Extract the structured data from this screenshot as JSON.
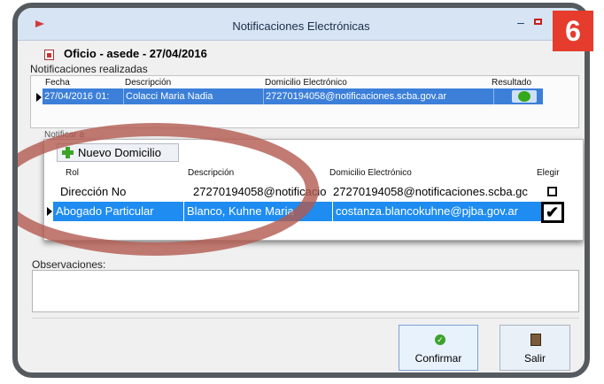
{
  "window": {
    "title": "Notificaciones Electrónicas",
    "minimize_glyph": "–"
  },
  "step_badge": "6",
  "document": {
    "title": "Oficio - asede - 27/04/2016"
  },
  "notifications": {
    "section_label": "Notificaciones realizadas",
    "columns": [
      "Fecha",
      "Descripción",
      "Domicilio Electrónico",
      "Resultado"
    ],
    "rows": [
      {
        "fecha": "27/04/2016 01:",
        "descripcion": "Colacci Maria Nadia",
        "domicilio": "27270194058@notificaciones.scba.gov.ar",
        "resultado_icon": "green-circle-icon"
      }
    ]
  },
  "notify_section": {
    "partial_label": "Notificar a"
  },
  "popup": {
    "new_button_label": "Nuevo Domicilio",
    "columns": [
      "Rol",
      "Descripción",
      "Domicilio Electrónico",
      "Elegir"
    ],
    "rows": [
      {
        "rol": "Dirección No",
        "descripcion": "27270194058@notificacio",
        "domicilio": "27270194058@notificaciones.scba.gc",
        "elegir": false
      },
      {
        "rol": "Abogado Particular",
        "descripcion": "Blanco, Kuhne Maria",
        "domicilio": "costanza.blancokuhne@pjba.gov.ar",
        "elegir": true
      }
    ]
  },
  "observations": {
    "label": "Observaciones:",
    "value": ""
  },
  "buttons": {
    "confirm_label": "Confirmar",
    "exit_label": "Salir"
  },
  "colors": {
    "selection": "#3b7fd9",
    "popup_selection": "#1e8cf0",
    "badge": "#e53c2e",
    "highlight_ellipse": "#b25a50"
  }
}
